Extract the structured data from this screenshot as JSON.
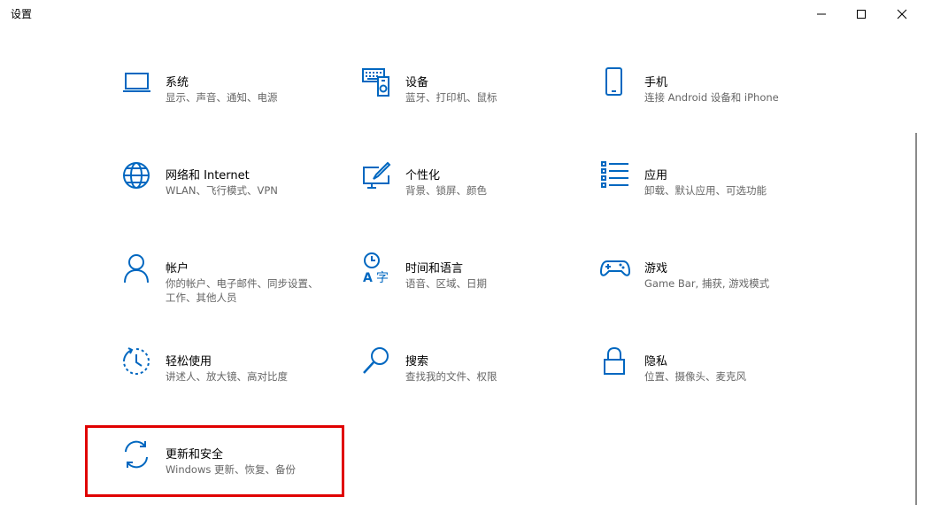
{
  "window": {
    "title": "设置",
    "controls": [
      "minimize",
      "maximize",
      "close"
    ]
  },
  "colors": {
    "accent": "#0067c0",
    "highlight": "#e00000"
  },
  "settings": [
    {
      "name": "系统",
      "desc": "显示、声音、通知、电源",
      "icon": "laptop-icon"
    },
    {
      "name": "设备",
      "desc": "蓝牙、打印机、鼠标",
      "icon": "keyboard-icon"
    },
    {
      "name": "手机",
      "desc": "连接 Android 设备和 iPhone",
      "icon": "phone-icon"
    },
    {
      "name": "网络和 Internet",
      "desc": "WLAN、飞行模式、VPN",
      "icon": "globe-icon"
    },
    {
      "name": "个性化",
      "desc": "背景、锁屏、颜色",
      "icon": "paint-icon"
    },
    {
      "name": "应用",
      "desc": "卸载、默认应用、可选功能",
      "icon": "apps-list-icon"
    },
    {
      "name": "帐户",
      "desc": "你的帐户、电子邮件、同步设置、工作、其他人员",
      "icon": "person-icon"
    },
    {
      "name": "时间和语言",
      "desc": "语音、区域、日期",
      "icon": "time-language-icon"
    },
    {
      "name": "游戏",
      "desc": "Game Bar, 捕获, 游戏模式",
      "icon": "gamepad-icon"
    },
    {
      "name": "轻松使用",
      "desc": "讲述人、放大镜、高对比度",
      "icon": "ease-of-access-icon"
    },
    {
      "name": "搜索",
      "desc": "查找我的文件、权限",
      "icon": "search-icon"
    },
    {
      "name": "隐私",
      "desc": "位置、摄像头、麦克风",
      "icon": "lock-icon"
    },
    {
      "name": "更新和安全",
      "desc": "Windows 更新、恢复、备份",
      "icon": "sync-icon"
    }
  ]
}
